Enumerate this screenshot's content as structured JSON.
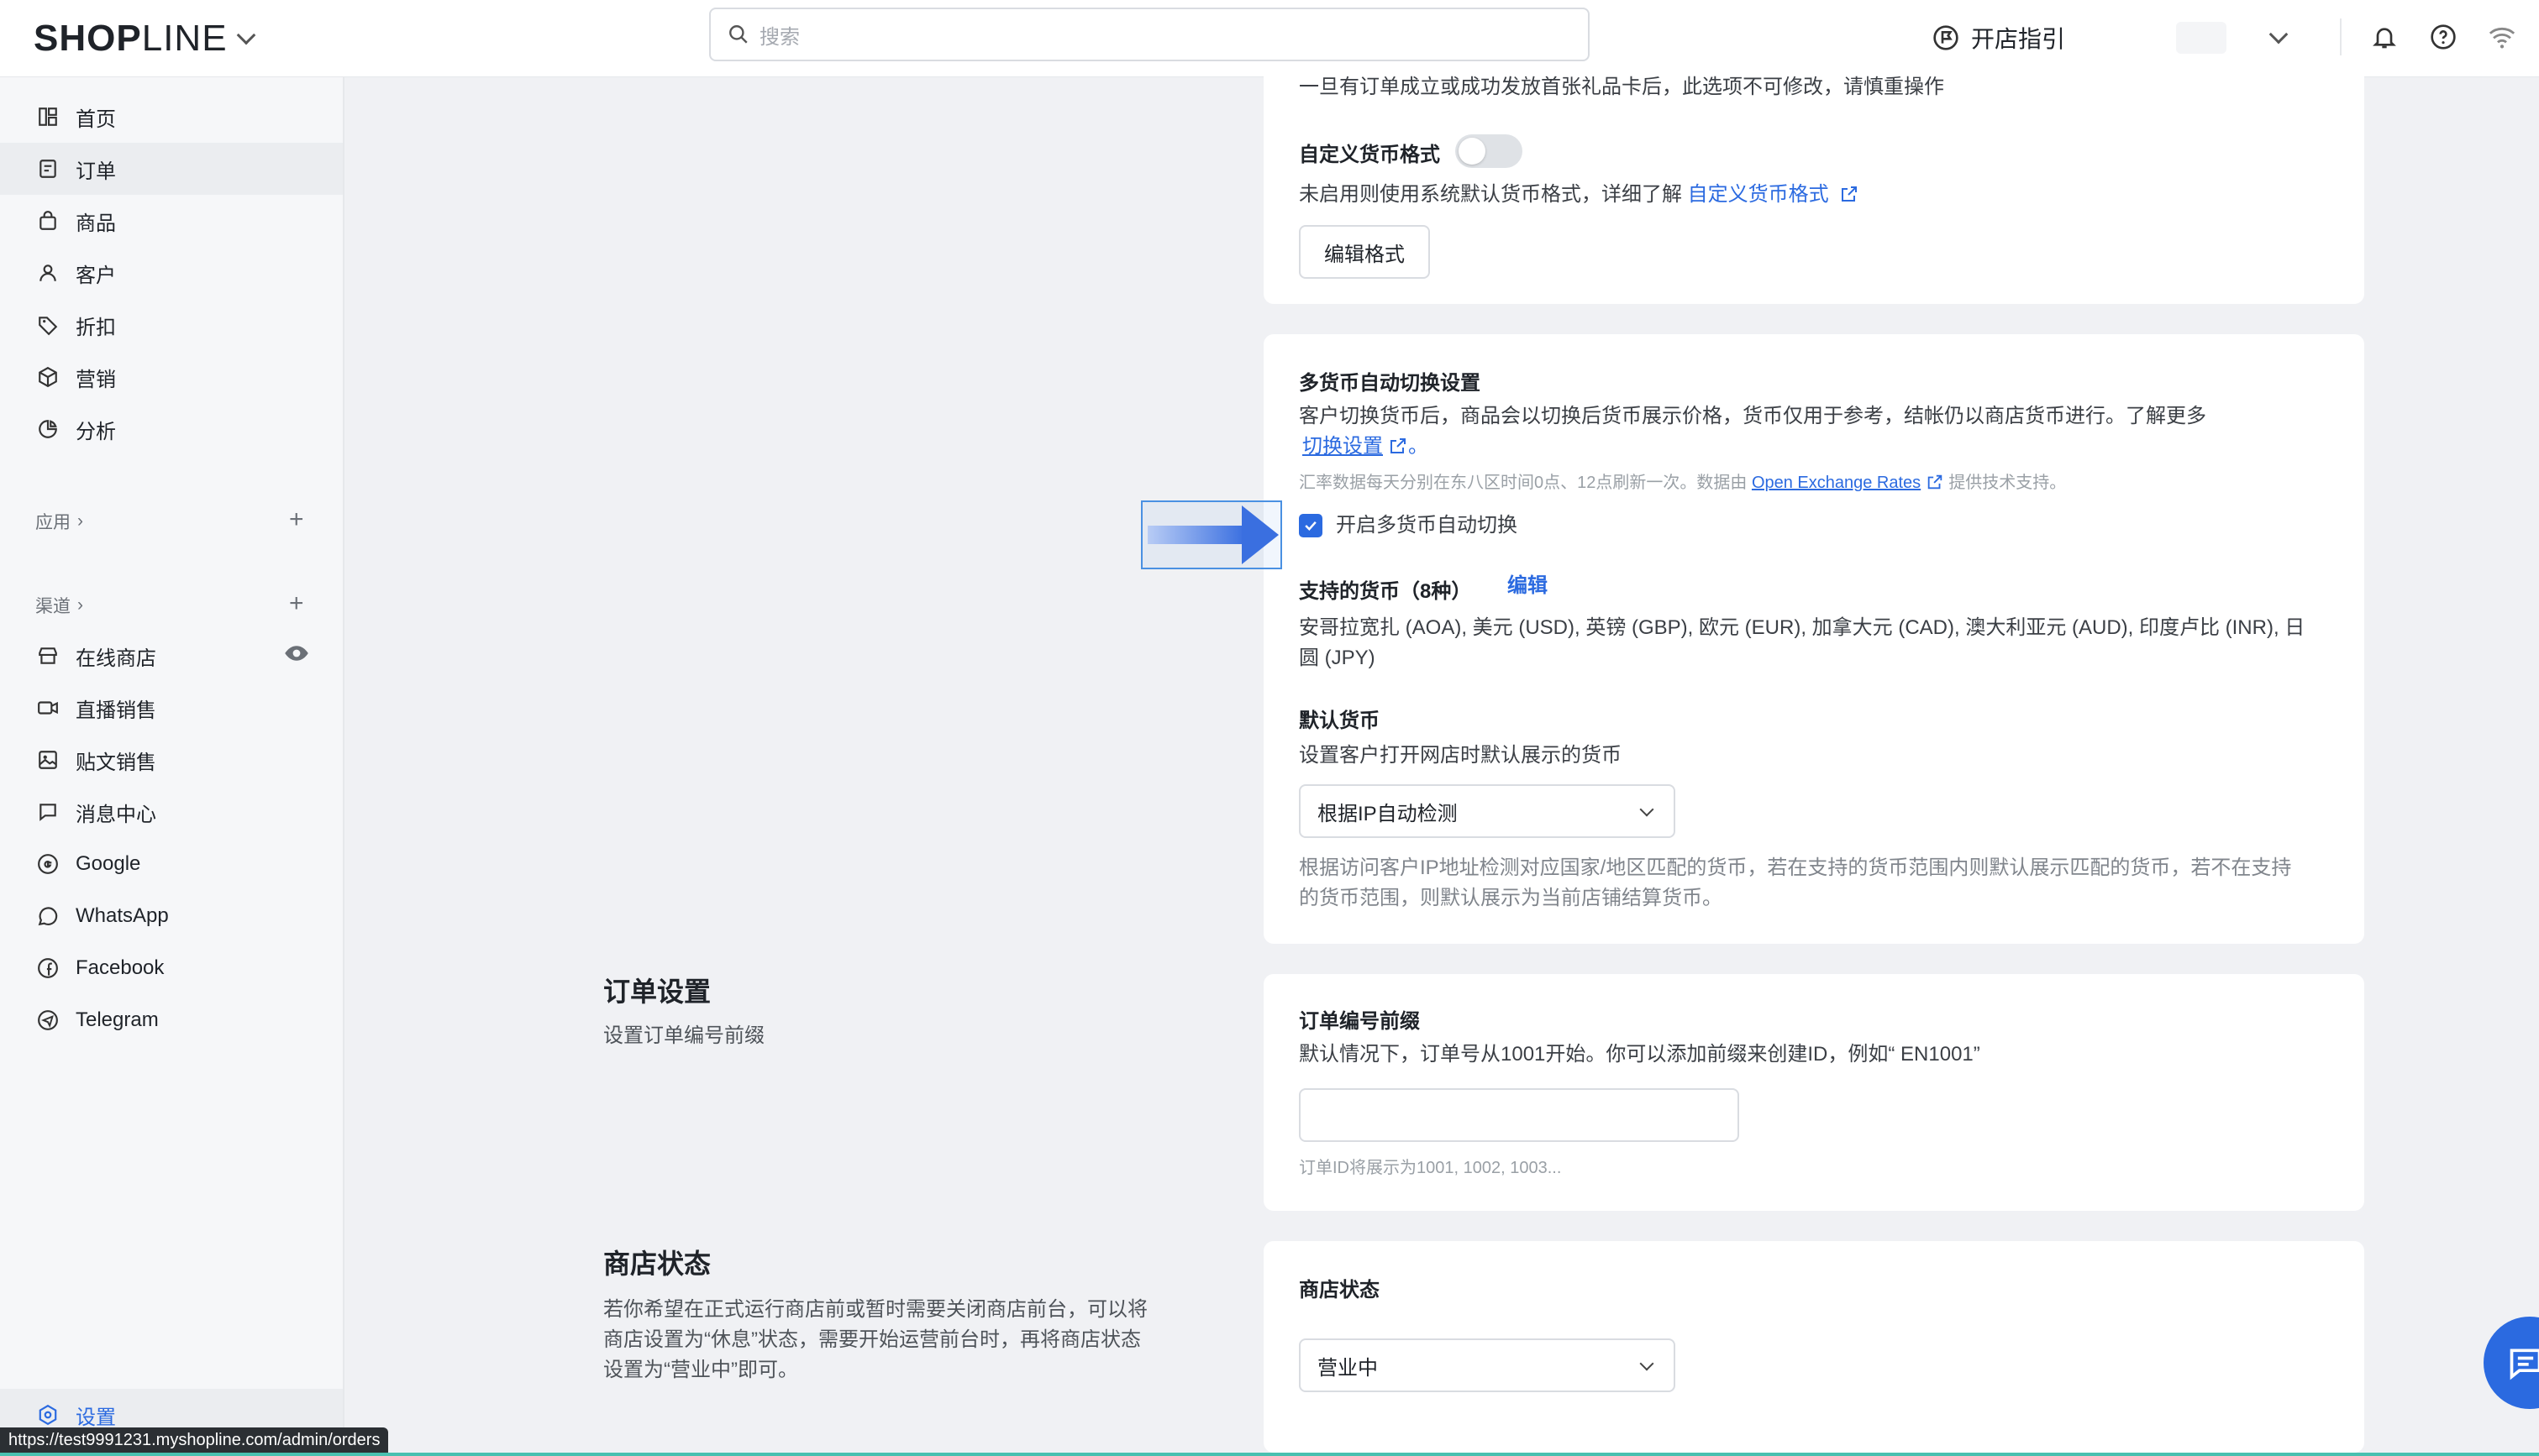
{
  "topbar": {
    "logo_bold": "SH",
    "logo_o": "O",
    "logo_p": "P",
    "logo_light": "LINE",
    "search_placeholder": "搜索",
    "guide_label": "开店指引"
  },
  "sidebar": {
    "items": [
      {
        "label": "首页",
        "icon": "home-icon"
      },
      {
        "label": "订单",
        "icon": "order-icon"
      },
      {
        "label": "商品",
        "icon": "bag-icon"
      },
      {
        "label": "客户",
        "icon": "user-icon"
      },
      {
        "label": "折扣",
        "icon": "tag-icon"
      },
      {
        "label": "营销",
        "icon": "cube-icon"
      },
      {
        "label": "分析",
        "icon": "pie-chart-icon"
      }
    ],
    "apps_label": "应用",
    "channels_label": "渠道",
    "channels": [
      {
        "label": "在线商店",
        "icon": "store-icon"
      },
      {
        "label": "直播销售",
        "icon": "video-icon"
      },
      {
        "label": "贴文销售",
        "icon": "image-icon"
      },
      {
        "label": "消息中心",
        "icon": "chat-icon"
      },
      {
        "label": "Google",
        "icon": "google-icon"
      },
      {
        "label": "WhatsApp",
        "icon": "whatsapp-icon"
      },
      {
        "label": "Facebook",
        "icon": "facebook-icon"
      },
      {
        "label": "Telegram",
        "icon": "telegram-icon"
      }
    ],
    "settings_label": "设置",
    "status_url": "https://test9991231.myshopline.com/admin/orders"
  },
  "currency_card": {
    "warning": "一旦有订单成立或成功发放首张礼品卡后，此选项不可修改，请慎重操作",
    "custom_format_label": "自定义货币格式",
    "custom_format_desc": "未启用则使用系统默认货币格式，详细了解",
    "custom_format_link": "自定义货币格式",
    "edit_format_button": "编辑格式"
  },
  "multi_currency": {
    "title": "多货币自动切换设置",
    "desc": "客户切换货币后，商品会以切换后货币展示价格，货币仅用于参考，结帐仍以商店货币进行。了解更多",
    "switch_link": "切换设置",
    "switch_link_suffix": "。",
    "rate_note_prefix": "汇率数据每天分别在东八区时间0点、12点刷新一次。数据由",
    "rate_provider": "Open Exchange Rates",
    "rate_note_suffix": "提供技术支持。",
    "enable_label": "开启多货币自动切换",
    "supported_title": "支持的货币（8种）",
    "edit_link": "编辑",
    "currencies_line1": "安哥拉宽扎 (AOA), 美元 (USD), 英镑 (GBP), 欧元 (EUR), 加拿大元 (CAD), 澳大利亚元 (AUD), 印度卢比 (INR), 日",
    "currencies_line2": "圆 (JPY)",
    "default_title": "默认货币",
    "default_desc": "设置客户打开网店时默认展示的货币",
    "default_select": "根据IP自动检测",
    "default_note_line1": "根据访问客户IP地址检测对应国家/地区匹配的货币，若在支持的货币范围内则默认展示匹配的货币，若不在支持",
    "default_note_line2": "的货币范围，则默认展示为当前店铺结算货币。"
  },
  "order_settings": {
    "section_title": "订单设置",
    "section_desc": "设置订单编号前缀",
    "prefix_title": "订单编号前缀",
    "prefix_desc": "默认情况下，订单号从1001开始。你可以添加前缀来创建ID，例如“ EN1001”",
    "prefix_value": "",
    "prefix_hint": "订单ID将展示为1001, 1002, 1003..."
  },
  "store_status": {
    "section_title": "商店状态",
    "section_desc_line1": "若你希望在正式运行商店前或暂时需要关闭商店前台，可以将",
    "section_desc_line2": "商店设置为“休息”状态，需要开始运营前台时，再将商店状态",
    "section_desc_line3": "设置为“营业中”即可。",
    "card_title": "商店状态",
    "status_select": "营业中"
  },
  "colors": {
    "accent": "#2b6ae0",
    "sidebar_bg": "#f6f7f9",
    "page_bg": "#f0f1f4"
  }
}
